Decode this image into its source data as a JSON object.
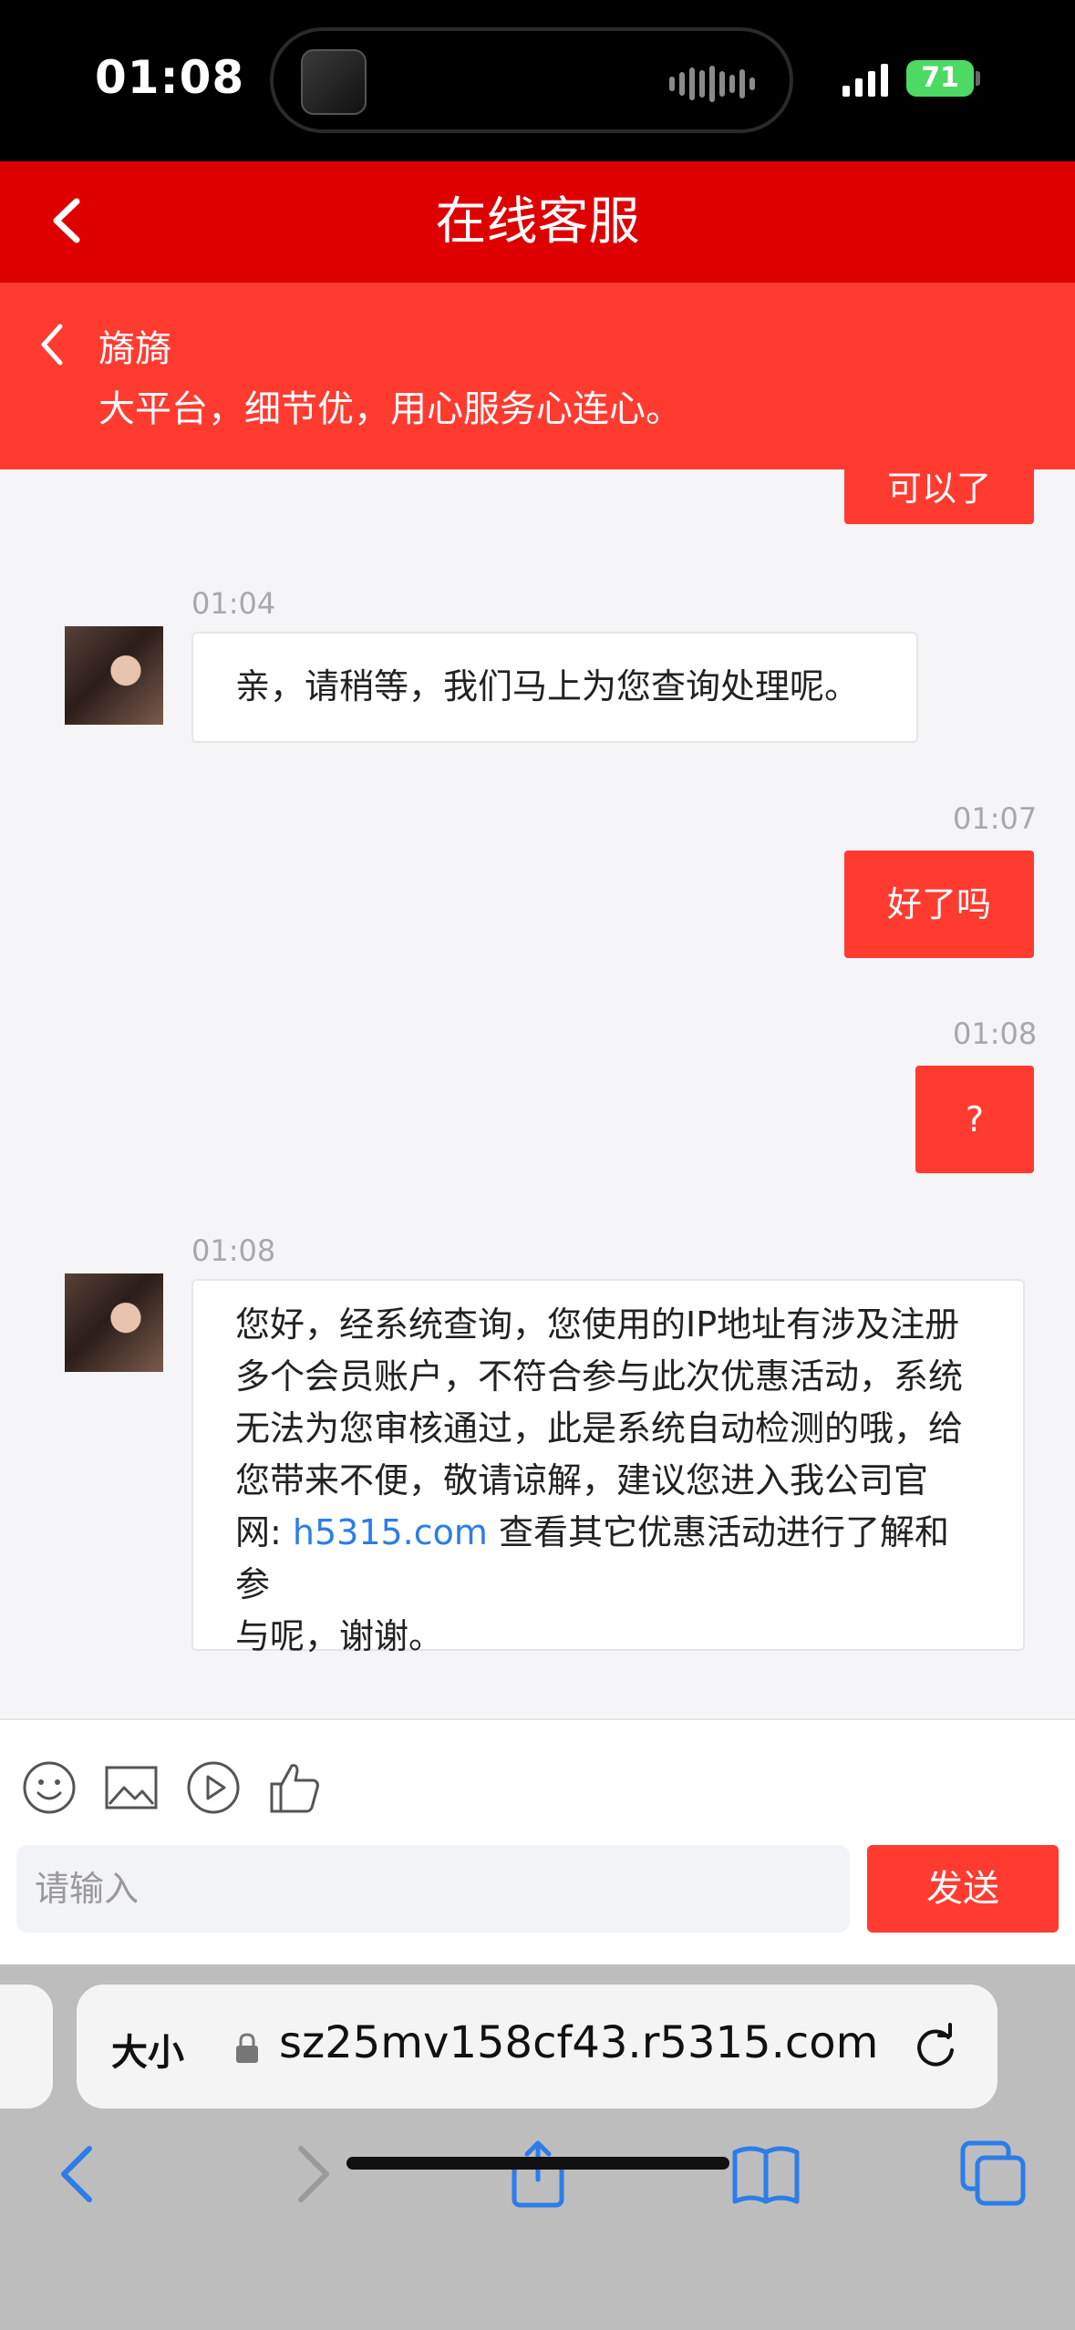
{
  "status_bar": {
    "time": "01:08",
    "battery": "71"
  },
  "header": {
    "title": "在线客服"
  },
  "agent": {
    "name": "旖旖",
    "slogan": "大平台，细节优，用心服务心连心。"
  },
  "messages": [
    {
      "side": "right",
      "text": "可以了",
      "partial": true
    },
    {
      "side": "left",
      "time": "01:04",
      "text": "亲，请稍等，我们马上为您查询处理呢。"
    },
    {
      "side": "right",
      "time": "01:07",
      "text": "好了吗"
    },
    {
      "side": "right",
      "time": "01:08",
      "text": "?"
    },
    {
      "side": "left",
      "time": "01:08",
      "lines": [
        "您好，经系统查询，您使用的IP地址有涉及注册",
        "多个会员账户，不符合参与此次优惠活动，系统",
        "无法为您审核通过，此是系统自动检测的哦，给",
        "您带来不便，敬请谅解，建议您进入我公司官"
      ],
      "link_prefix": "网: ",
      "link": "h5315.com",
      "link_suffix": " 查看其它优惠活动进行了解和参",
      "last_line": "与呢，谢谢。"
    }
  ],
  "toolbar": {
    "icons": [
      "emoji-icon",
      "image-icon",
      "video-icon",
      "like-icon"
    ],
    "input_placeholder": "请输入",
    "send_label": "发送"
  },
  "browser": {
    "text_size_label": "大小",
    "url": "sz25mv158cf43.r5315.com"
  }
}
